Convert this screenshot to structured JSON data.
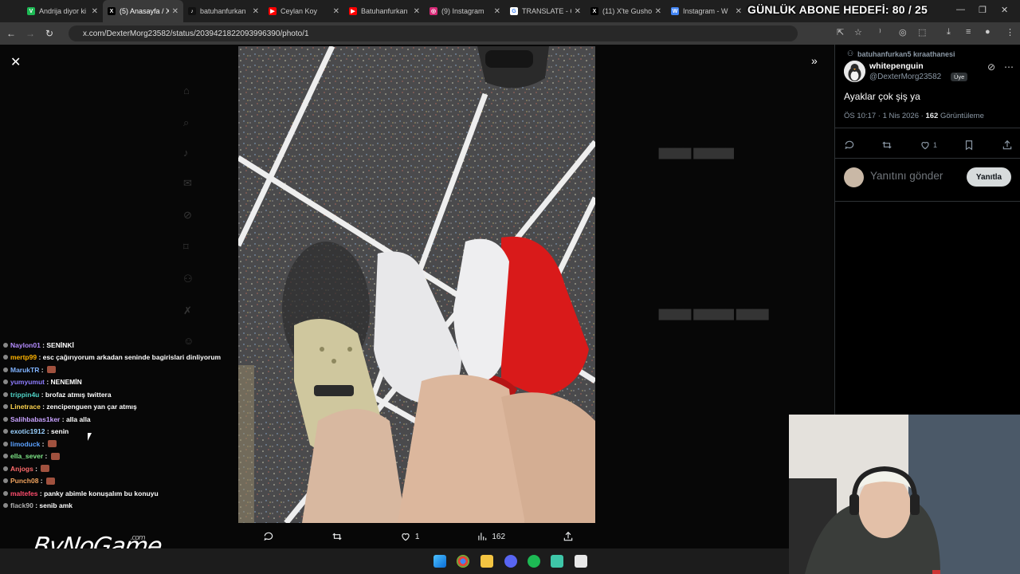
{
  "browser": {
    "tabs": [
      {
        "title": "Andrija diyor ki",
        "favicon": "vine-icon",
        "color": "#1db954",
        "glyph": "V"
      },
      {
        "title": "(5) Anasayfa / X",
        "favicon": "x-icon",
        "color": "#000000",
        "glyph": "X"
      },
      {
        "title": "batuhanfurkan",
        "favicon": "tiktok-icon",
        "color": "#111111",
        "glyph": "♪"
      },
      {
        "title": "Ceylan Koy",
        "favicon": "youtube-icon",
        "color": "#ff0000",
        "glyph": "▶"
      },
      {
        "title": "Batuhanfurkan",
        "favicon": "youtube-icon",
        "color": "#ff0000",
        "glyph": "▶"
      },
      {
        "title": "(9) Instagram",
        "favicon": "instagram-icon",
        "color": "#d62976",
        "glyph": "◎"
      },
      {
        "title": "TRANSLATE - C",
        "favicon": "google-icon",
        "color": "#ffffff",
        "glyph": "G"
      },
      {
        "title": "(11) X'te Gusho",
        "favicon": "x-icon",
        "color": "#000000",
        "glyph": "X"
      },
      {
        "title": "Instagram - W",
        "favicon": "web-icon",
        "color": "#4285f4",
        "glyph": "W"
      }
    ],
    "url": "x.com/DexterMorg23582/status/2039421822093996390/photo/1"
  },
  "stream_overlay": {
    "goal_text": "GÜNLÜK ABONE HEDEFİ: 80 / 25",
    "logo_text": "ByNoGame",
    "logo_suffix": ".com"
  },
  "chat": [
    {
      "user": "Naylon01",
      "color": "#b48cff",
      "message": "SENİNKİ",
      "emote": false
    },
    {
      "user": "mertp99",
      "color": "#ffb300",
      "message": "esc çağırıyorum arkadan seninde bagirislari dinliyorum",
      "emote": false
    },
    {
      "user": "MarukTR",
      "color": "#7fb2ff",
      "message": "",
      "emote": true
    },
    {
      "user": "yumyumut",
      "color": "#8e7dff",
      "message": "NENEMİN",
      "emote": false
    },
    {
      "user": "trippin4u",
      "color": "#4fd1c5",
      "message": "brofaz atmış twittera",
      "emote": false
    },
    {
      "user": "Linetrace",
      "color": "#ffd54f",
      "message": "zencipenguen yan çar atmış",
      "emote": false
    },
    {
      "user": "Salihbabas1ker",
      "color": "#c8a2ff",
      "message": "alla alla",
      "emote": false
    },
    {
      "user": "exotic1912",
      "color": "#9ad1ff",
      "message": "senin",
      "emote": false
    },
    {
      "user": "limoduck",
      "color": "#5aa0ff",
      "message": "",
      "emote": true
    },
    {
      "user": "ella_sever",
      "color": "#7ee787",
      "message": "",
      "emote": true
    },
    {
      "user": "Anjogs",
      "color": "#ff6b6b",
      "message": "",
      "emote": true
    },
    {
      "user": "Punch08",
      "color": "#f0a35e",
      "message": "",
      "emote": true
    },
    {
      "user": "maltefes",
      "color": "#ff4d6d",
      "message": "panky abimle konuşalım bu konuyu",
      "emote": false
    },
    {
      "user": "flack90",
      "color": "#b0b0b0",
      "message": "senib amk",
      "emote": false
    }
  ],
  "viewer": {
    "actions": {
      "reply": "",
      "retweet": "",
      "likes": "1",
      "views": "162"
    }
  },
  "tweet": {
    "retweet_context": "batuhanfurkan5 kıraathanesi",
    "name": "whitepenguin",
    "handle": "@DexterMorg23582",
    "badge": "Üye",
    "text": "Ayaklar çok şiş ya",
    "time": "ÖS 10:17 · 1 Nis 2026 · ",
    "views_count": "162",
    "views_label": " Görüntüleme",
    "likes": "1",
    "reply_placeholder": "Yanıtını gönder",
    "reply_button": "Yanıtla"
  }
}
